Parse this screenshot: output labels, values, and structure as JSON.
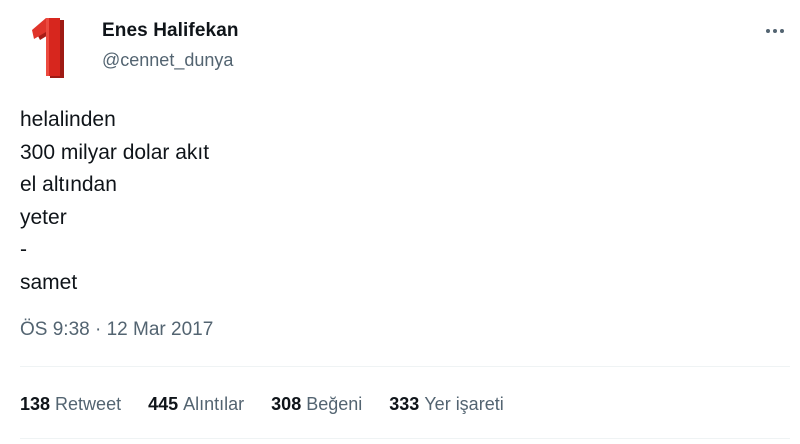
{
  "author": {
    "display_name": "Enes Halifekan",
    "handle": "@cennet_dunya",
    "avatar_icon": "red-number-one-icon",
    "avatar_glyph": "1"
  },
  "menu": {
    "more_icon": "more-horizontal-icon"
  },
  "tweet": {
    "lines": [
      "helalinden",
      "300 milyar dolar akıt",
      "el altından",
      "yeter",
      "-",
      "samet"
    ],
    "time": "ÖS 9:38",
    "separator": "·",
    "date": "12 Mar 2017"
  },
  "stats": [
    {
      "value": "138",
      "label": "Retweet"
    },
    {
      "value": "445",
      "label": "Alıntılar"
    },
    {
      "value": "308",
      "label": "Beğeni"
    },
    {
      "value": "333",
      "label": "Yer işareti"
    }
  ],
  "colors": {
    "text_primary": "#0f1419",
    "text_secondary": "#536471",
    "divider": "#eff3f4",
    "avatar_red": "#d7261e"
  }
}
